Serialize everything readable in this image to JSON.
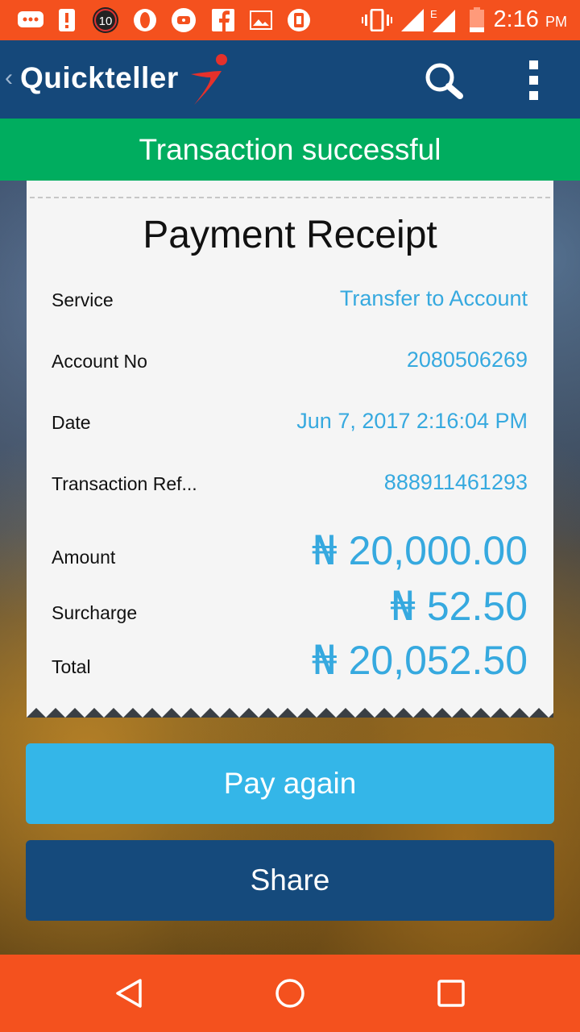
{
  "status_bar": {
    "time": "2:16",
    "ampm": "PM",
    "notification_badge": "10",
    "network": "E",
    "icons": [
      "chat-icon",
      "alert-icon",
      "badge-icon",
      "opera-icon",
      "record-icon",
      "facebook-icon",
      "gallery-icon",
      "security-icon",
      "vibrate-icon",
      "signal-icon",
      "signal-e-icon",
      "battery-icon"
    ]
  },
  "app_bar": {
    "brand": "Quickteller",
    "icons": [
      "back-chevron-icon",
      "search-icon",
      "overflow-menu-icon"
    ]
  },
  "banner": {
    "text": "Transaction successful"
  },
  "receipt": {
    "title": "Payment Receipt",
    "rows": [
      {
        "label": "Service",
        "value": "Transfer to Account"
      },
      {
        "label": "Account No",
        "value": "2080506269"
      },
      {
        "label": "Date",
        "value": "Jun 7, 2017 2:16:04 PM"
      },
      {
        "label": "Transaction Ref...",
        "value": "888911461293"
      }
    ],
    "amounts": [
      {
        "label": "Amount",
        "currency": "₦",
        "value": "20,000.00"
      },
      {
        "label": "Surcharge",
        "currency": "₦",
        "value": "52.50"
      },
      {
        "label": "Total",
        "currency": "₦",
        "value": "20,052.50"
      }
    ]
  },
  "buttons": {
    "pay_again": "Pay again",
    "share": "Share"
  },
  "nav": {
    "icons": [
      "back-icon",
      "home-icon",
      "recents-icon"
    ]
  },
  "colors": {
    "status_bar": "#f4511e",
    "app_bar": "#15487a",
    "success": "#00ad5f",
    "accent_value": "#36a9df",
    "pay_button": "#34b6e8",
    "share_button": "#154a7c"
  }
}
